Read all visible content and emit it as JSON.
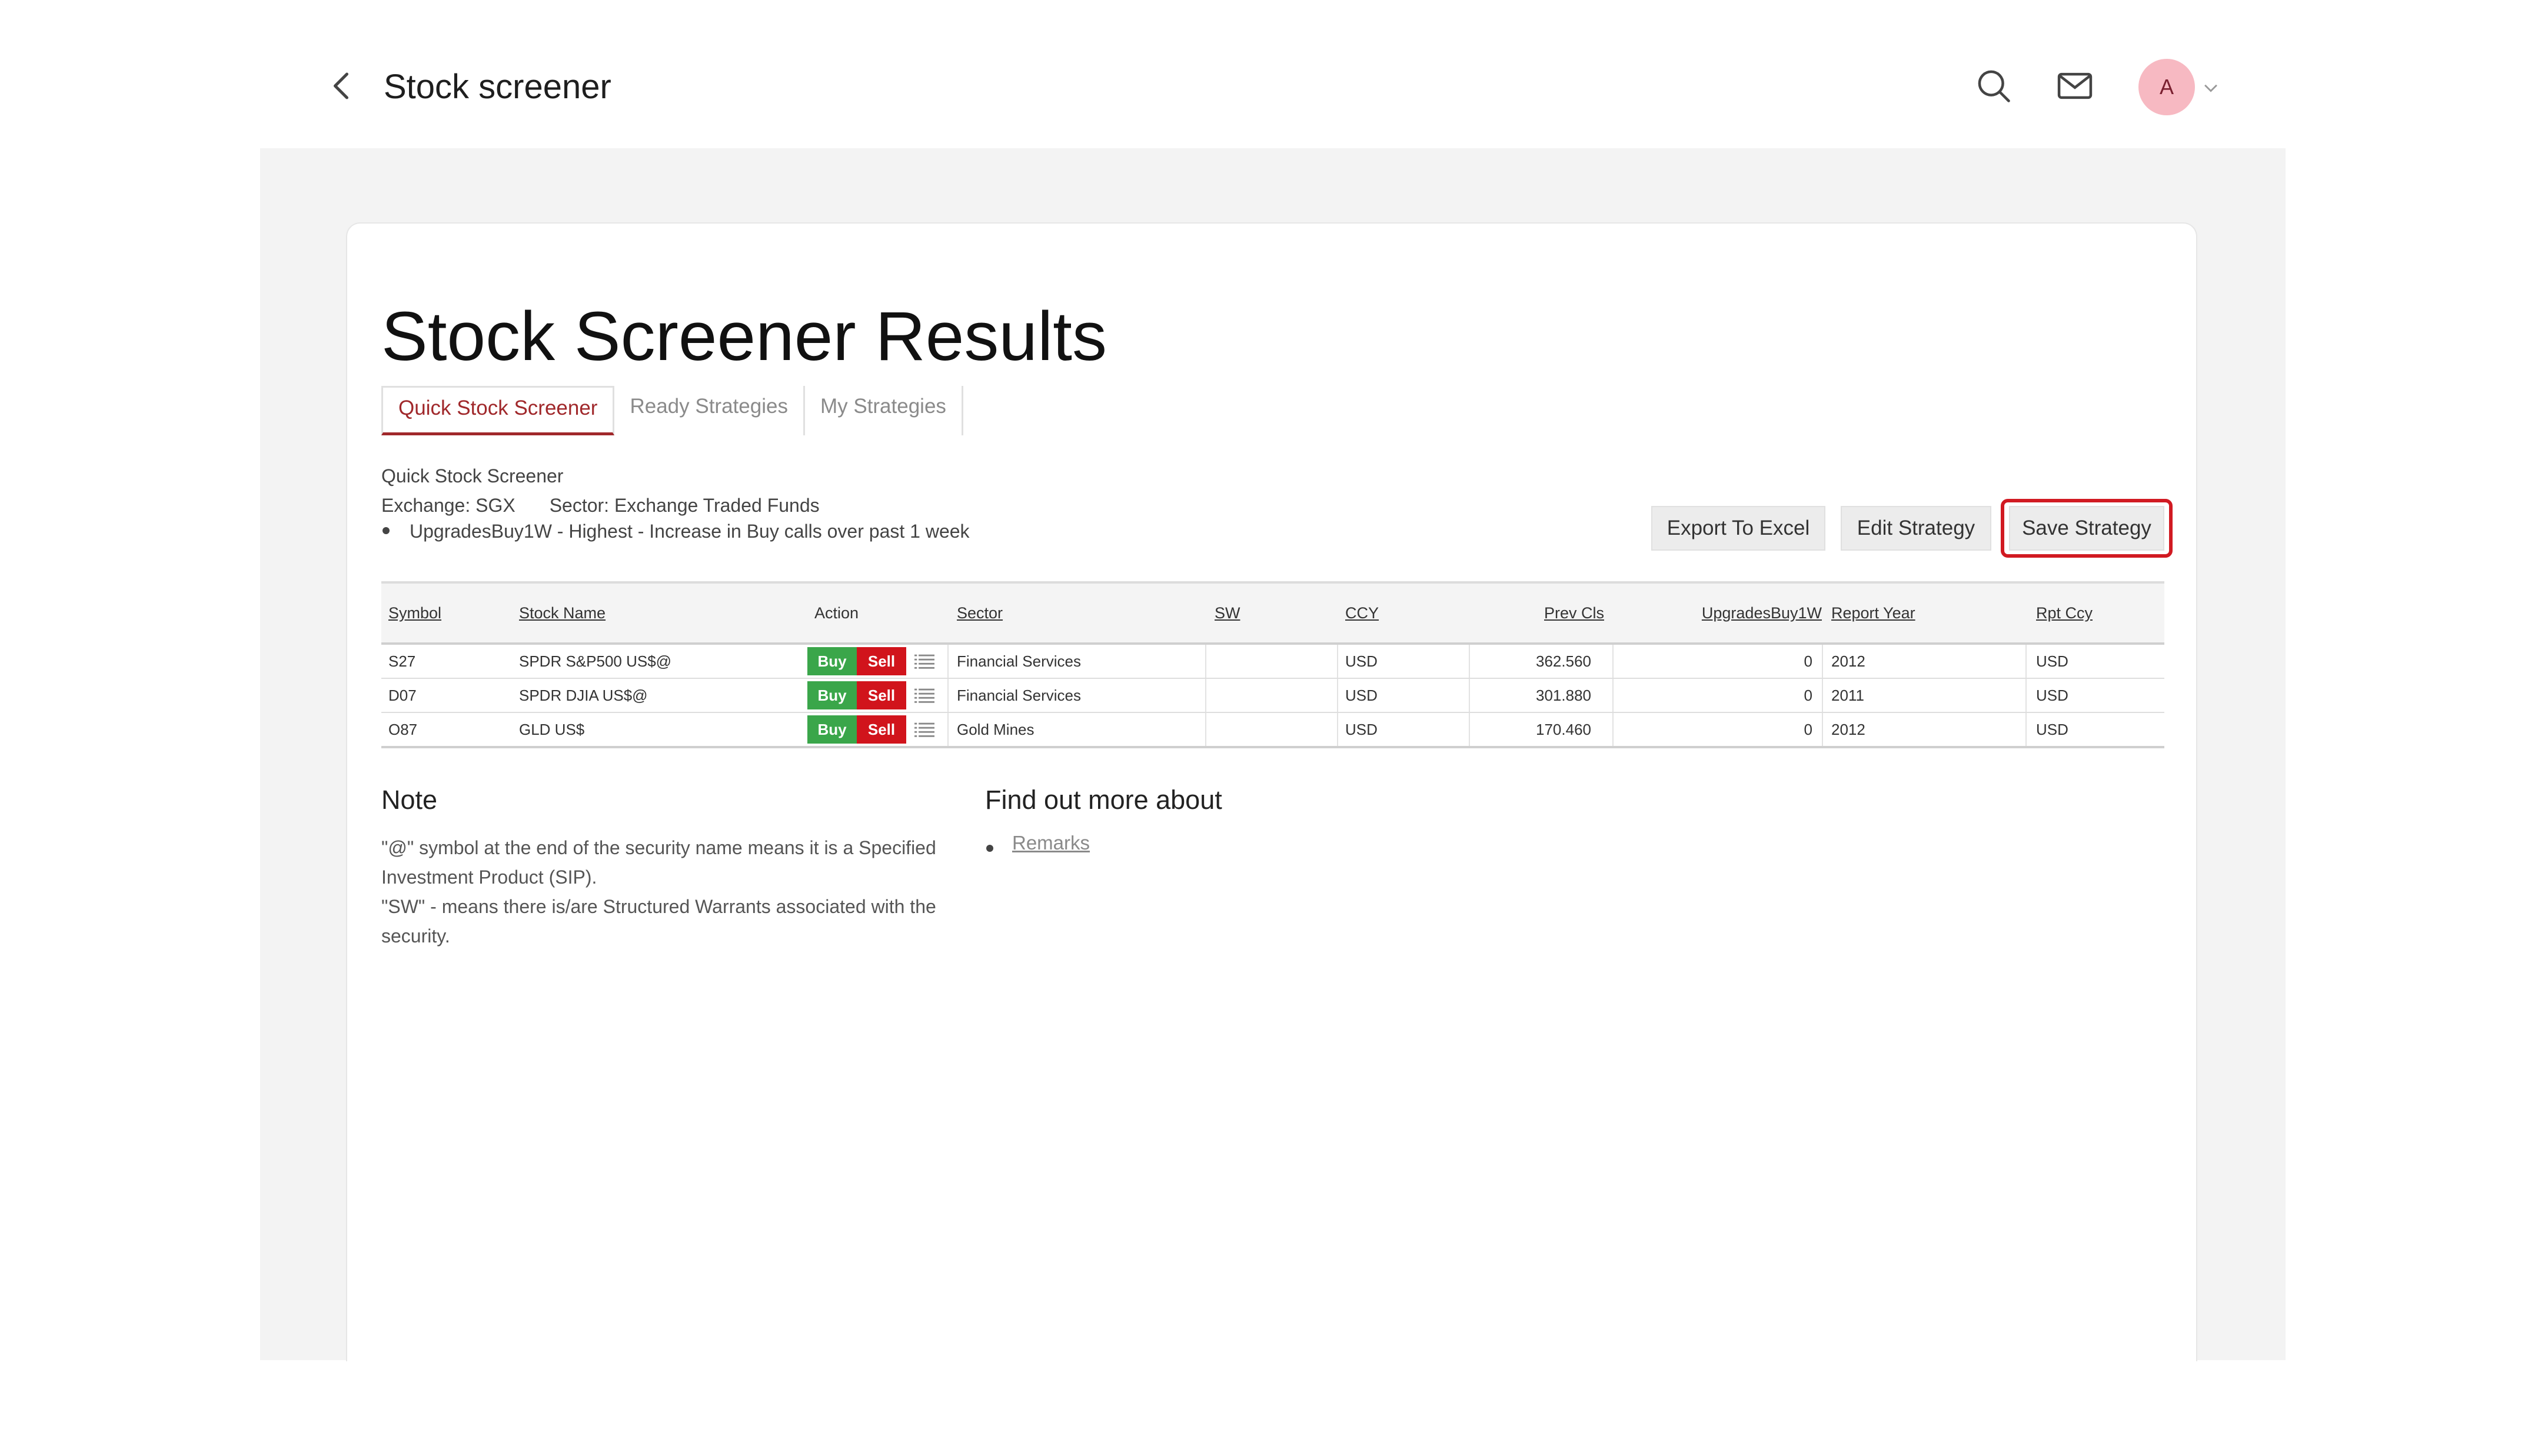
{
  "header": {
    "title": "Stock screener",
    "avatar_initial": "A",
    "icons": [
      "back-arrow-icon",
      "search-icon",
      "mail-icon",
      "chevron-down-icon"
    ]
  },
  "page_title": "Stock Screener Results",
  "tabs": [
    {
      "label": "Quick Stock Screener",
      "active": true
    },
    {
      "label": "Ready Strategies",
      "active": false
    },
    {
      "label": "My Strategies",
      "active": false
    }
  ],
  "criteria": {
    "name": "Quick Stock Screener",
    "exchange": "Exchange: SGX",
    "sector": "Sector: Exchange Traded Funds",
    "rule": "UpgradesBuy1W - Highest - Increase in Buy calls over past 1 week"
  },
  "actions": {
    "export": "Export To Excel",
    "edit": "Edit Strategy",
    "save": "Save Strategy"
  },
  "table": {
    "headers": {
      "symbol": "Symbol",
      "stock_name": "Stock Name",
      "action": "Action",
      "sector": "Sector",
      "sw": "SW",
      "ccy": "CCY",
      "prev_cls": "Prev Cls",
      "upgrades": "UpgradesBuy1W",
      "report_year": "Report Year",
      "rpt_ccy": "Rpt Ccy"
    },
    "buy_label": "Buy",
    "sell_label": "Sell",
    "rows": [
      {
        "symbol": "S27",
        "name": "SPDR S&P500 US$@",
        "sector": "Financial Services",
        "sw": "",
        "ccy": "USD",
        "prev_cls": "362.560",
        "upgrades": "0",
        "report_year": "2012",
        "rpt_ccy": "USD"
      },
      {
        "symbol": "D07",
        "name": "SPDR DJIA US$@",
        "sector": "Financial Services",
        "sw": "",
        "ccy": "USD",
        "prev_cls": "301.880",
        "upgrades": "0",
        "report_year": "2011",
        "rpt_ccy": "USD"
      },
      {
        "symbol": "O87",
        "name": "GLD US$",
        "sector": "Gold Mines",
        "sw": "",
        "ccy": "USD",
        "prev_cls": "170.460",
        "upgrades": "0",
        "report_year": "2012",
        "rpt_ccy": "USD"
      }
    ]
  },
  "note": {
    "heading": "Note",
    "lines": [
      "\"@\" symbol at the end of the security name means it is a Specified",
      "Investment Product (SIP).",
      "\"SW\" - means there is/are Structured Warrants associated with the",
      "security."
    ]
  },
  "find_more": {
    "heading": "Find out more about",
    "link": "Remarks"
  },
  "colors": {
    "accent": "#a0282b",
    "buy": "#3aa64a",
    "sell": "#d1141c",
    "highlight": "#d11a22"
  }
}
